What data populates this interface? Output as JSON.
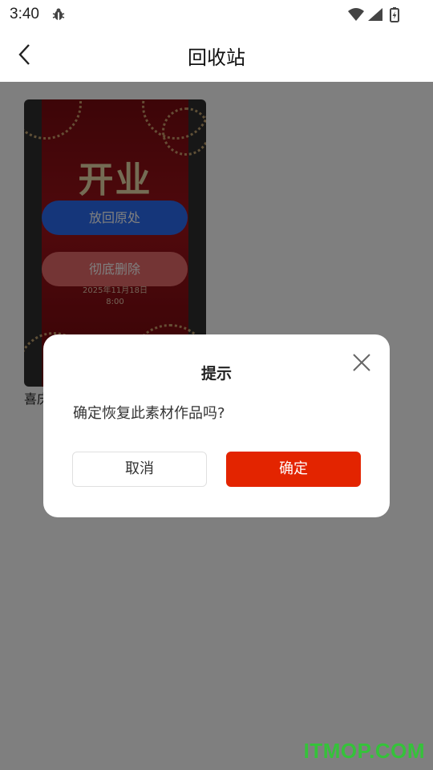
{
  "status_bar": {
    "time": "3:40",
    "icons": [
      "bug-icon",
      "wifi-icon",
      "signal-icon",
      "battery-charging-icon"
    ]
  },
  "header": {
    "title": "回收站",
    "back_icon": "chevron-left-icon"
  },
  "recycle_item": {
    "poster_headline": "开业",
    "poster_date": "2025年11月18日",
    "poster_time": "8:00",
    "restore_label": "放回原处",
    "delete_label": "彻底删除",
    "caption": "喜庆"
  },
  "dialog": {
    "title": "提示",
    "message": "确定恢复此素材作品吗?",
    "cancel_label": "取消",
    "confirm_label": "确定",
    "close_icon": "close-icon"
  },
  "watermark": "ITMOP.COM",
  "colors": {
    "accent_red": "#e32400",
    "restore_blue": "#2a6df4",
    "delete_red": "#e86a6a",
    "watermark_green": "#35c23a"
  }
}
